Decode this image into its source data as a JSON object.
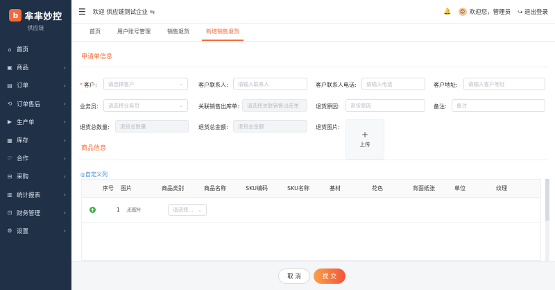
{
  "sidebar": {
    "logo_mark": "b",
    "logo_text": "芈芈妙控",
    "logo_sub": "供应链",
    "items": [
      {
        "label": "首页",
        "icon": "home-icon",
        "glyph": "⌂",
        "arrow": ""
      },
      {
        "label": "商品",
        "icon": "goods-icon",
        "glyph": "▣",
        "arrow": "›"
      },
      {
        "label": "订单",
        "icon": "order-icon",
        "glyph": "▤",
        "arrow": "›"
      },
      {
        "label": "订单售后",
        "icon": "after-sale-icon",
        "glyph": "⟲",
        "arrow": "›"
      },
      {
        "label": "生产单",
        "icon": "production-icon",
        "glyph": "▶",
        "arrow": "›"
      },
      {
        "label": "库存",
        "icon": "inventory-icon",
        "glyph": "▦",
        "arrow": "›"
      },
      {
        "label": "合作",
        "icon": "heart-icon",
        "glyph": "♡",
        "arrow": "›"
      },
      {
        "label": "采购",
        "icon": "purchase-icon",
        "glyph": "⊟",
        "arrow": "›"
      },
      {
        "label": "统计报表",
        "icon": "report-icon",
        "glyph": "▥",
        "arrow": "›"
      },
      {
        "label": "财务管理",
        "icon": "finance-icon",
        "glyph": "⊡",
        "arrow": "›"
      },
      {
        "label": "设置",
        "icon": "settings-icon",
        "glyph": "⚙",
        "arrow": "›"
      }
    ]
  },
  "header": {
    "company": "欢迎 供应链测试企业",
    "swap_glyph": "⇆",
    "welcome": "欢迎您，管理员",
    "logout": "退出登录",
    "avatar_glyph": "☺",
    "bell_glyph": "🔔",
    "logout_glyph": "↪"
  },
  "tabs": [
    {
      "label": "首页",
      "active": false
    },
    {
      "label": "用户账号管理",
      "active": false
    },
    {
      "label": "销售退货",
      "active": false
    },
    {
      "label": "新增销售退货",
      "active": true
    }
  ],
  "form": {
    "section1_title": "申请单信息",
    "customer_label": "客户:",
    "customer_placeholder": "请选择客户",
    "contact_label": "客户联系人:",
    "contact_placeholder": "请输入联系人",
    "phone_label": "客户联系人电话:",
    "phone_placeholder": "请输入电话",
    "address_label": "客户地址:",
    "address_placeholder": "请输入客户地址",
    "salesman_label": "业务员:",
    "salesman_placeholder": "请选择业务员",
    "outbound_label": "关联销售出库单:",
    "outbound_placeholder": "请选择关联销售出库单",
    "reason_label": "退货原因:",
    "reason_placeholder": "退货原因",
    "remark_label": "备注:",
    "remark_placeholder": "备注",
    "qty_label": "退货总数量:",
    "qty_placeholder": "退货总数量",
    "amount_label": "退货总金额:",
    "amount_placeholder": "退货总金额",
    "image_label": "退货图片:",
    "upload_plus": "+",
    "upload_label": "上传",
    "section2_title": "商品信息"
  },
  "goods": {
    "custom_col": "◎自定义列",
    "columns": [
      "序号",
      "图片",
      "商品类别",
      "商品名称",
      "SKU编码",
      "SKU名称",
      "基材",
      "花色",
      "背面纸张",
      "单位",
      "纹理"
    ],
    "row": {
      "index": "1",
      "image": "无图片",
      "category_placeholder": "请选择..."
    }
  },
  "footer": {
    "cancel": "取 消",
    "submit": "提 交"
  }
}
